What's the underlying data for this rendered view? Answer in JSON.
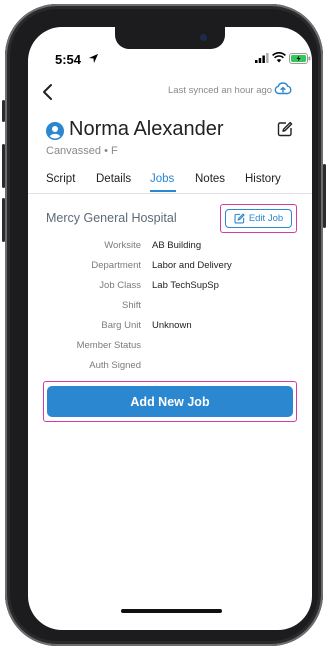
{
  "status_bar": {
    "time": "5:54"
  },
  "header": {
    "last_synced": "Last synced an hour ago"
  },
  "contact": {
    "name": "Norma Alexander",
    "subtitle": "Canvassed • F"
  },
  "tabs": [
    {
      "label": "Script"
    },
    {
      "label": "Details"
    },
    {
      "label": "Jobs",
      "active": true
    },
    {
      "label": "Notes"
    },
    {
      "label": "History"
    }
  ],
  "job": {
    "employer": "Mercy General Hospital",
    "edit_label": "Edit Job",
    "fields": [
      {
        "label": "Worksite",
        "value": "AB Building"
      },
      {
        "label": "Department",
        "value": "Labor and Delivery"
      },
      {
        "label": "Job Class",
        "value": "Lab TechSupSp"
      },
      {
        "label": "Shift",
        "value": ""
      },
      {
        "label": "Barg Unit",
        "value": "Unknown"
      },
      {
        "label": "Member Status",
        "value": ""
      },
      {
        "label": "Auth Signed",
        "value": ""
      }
    ]
  },
  "actions": {
    "add_job_label": "Add New Job"
  },
  "colors": {
    "accent": "#2a87d0",
    "highlight": "#d63aa6"
  }
}
